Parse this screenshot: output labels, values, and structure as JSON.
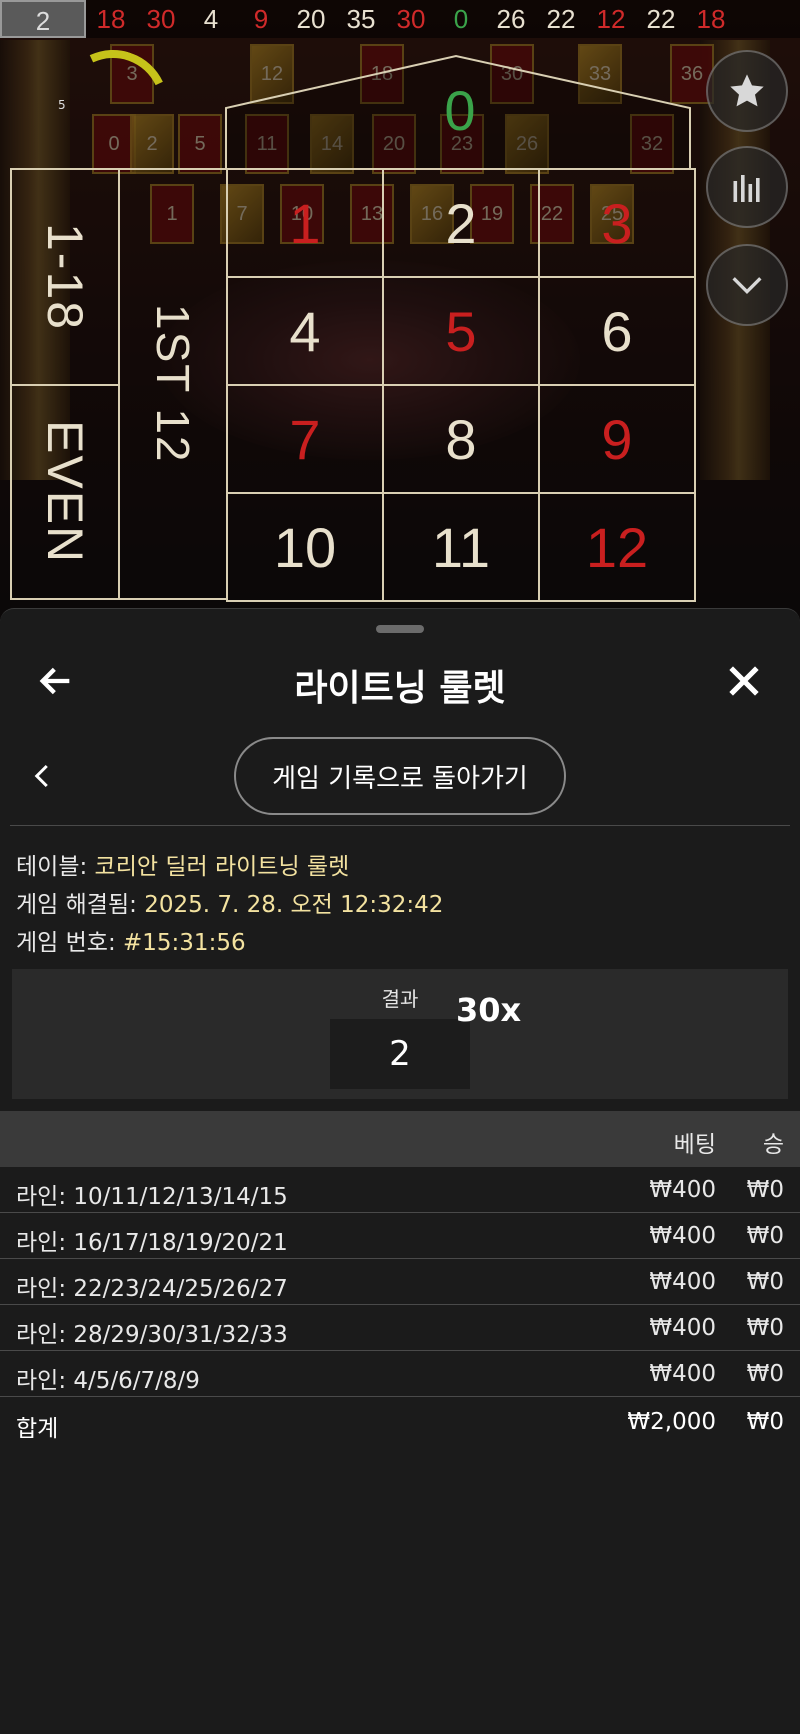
{
  "game": {
    "history": [
      {
        "n": "2",
        "c": "first"
      },
      {
        "n": "18",
        "c": "red"
      },
      {
        "n": "30",
        "c": "red"
      },
      {
        "n": "4",
        "c": "black"
      },
      {
        "n": "9",
        "c": "red"
      },
      {
        "n": "20",
        "c": "black"
      },
      {
        "n": "35",
        "c": "black"
      },
      {
        "n": "30",
        "c": "red"
      },
      {
        "n": "0",
        "c": "green"
      },
      {
        "n": "26",
        "c": "black"
      },
      {
        "n": "22",
        "c": "black"
      },
      {
        "n": "12",
        "c": "red"
      },
      {
        "n": "22",
        "c": "black"
      },
      {
        "n": "18",
        "c": "red"
      }
    ],
    "timer_value": "5",
    "zero": "0",
    "outside_1_18": "1-18",
    "outside_even": "EVEN",
    "dozen_label": "1ST 12",
    "numbers": [
      {
        "n": "1",
        "red": true
      },
      {
        "n": "2",
        "red": false
      },
      {
        "n": "3",
        "red": true
      },
      {
        "n": "4",
        "red": false
      },
      {
        "n": "5",
        "red": true
      },
      {
        "n": "6",
        "red": false
      },
      {
        "n": "7",
        "red": true
      },
      {
        "n": "8",
        "red": false
      },
      {
        "n": "9",
        "red": true
      },
      {
        "n": "10",
        "red": false
      },
      {
        "n": "11",
        "red": false
      },
      {
        "n": "12",
        "red": true
      }
    ],
    "cards": [
      "3",
      "12",
      "18",
      "30",
      "33",
      "36",
      "0",
      "2",
      "5",
      "11",
      "14",
      "20",
      "23",
      "26",
      "32",
      "1",
      "7",
      "10",
      "13",
      "16",
      "19",
      "22",
      "25"
    ]
  },
  "sheet": {
    "title": "라이트닝 룰렛",
    "back_to_history": "게임 기록으로 돌아가기",
    "info": {
      "table_label": "테이블:",
      "table_value": "코리안 딜러 라이트닝 룰렛",
      "resolved_label": "게임 해결됨:",
      "resolved_value": "2025. 7. 28. 오전 12:32:42",
      "number_label": "게임 번호:",
      "number_value": "#15:31:56"
    },
    "result": {
      "label": "결과",
      "value": "2",
      "multiplier": "30x"
    },
    "bets": {
      "col_bet": "베팅",
      "col_win": "승",
      "rows": [
        {
          "label": "라인: 10/11/12/13/14/15",
          "bet": "₩400",
          "win": "₩0"
        },
        {
          "label": "라인: 16/17/18/19/20/21",
          "bet": "₩400",
          "win": "₩0"
        },
        {
          "label": "라인: 22/23/24/25/26/27",
          "bet": "₩400",
          "win": "₩0"
        },
        {
          "label": "라인: 28/29/30/31/32/33",
          "bet": "₩400",
          "win": "₩0"
        },
        {
          "label": "라인: 4/5/6/7/8/9",
          "bet": "₩400",
          "win": "₩0"
        }
      ],
      "total_label": "합계",
      "total_bet": "₩2,000",
      "total_win": "₩0"
    }
  },
  "colors": {
    "red": "#c91f1f",
    "green": "#3aa34a",
    "accent_value": "#f3e2a0",
    "sheet_bg": "#1b1b1b"
  },
  "icons": [
    "star-icon",
    "stats-icon",
    "chevron-down-icon",
    "arrow-left-icon",
    "close-icon",
    "chevron-left-icon"
  ]
}
